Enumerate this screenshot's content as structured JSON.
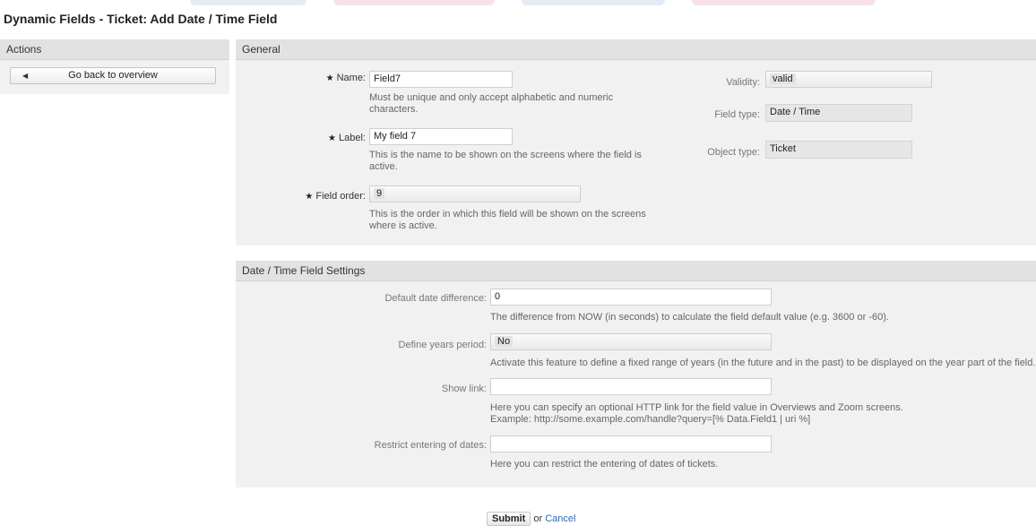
{
  "page_title": "Dynamic Fields - Ticket: Add Date / Time Field",
  "sidebar": {
    "title": "Actions",
    "back_button": "Go back to overview"
  },
  "general": {
    "title": "General",
    "name_label": "Name:",
    "name_value": "Field7",
    "name_hint": "Must be unique and only accept alphabetic and numeric characters.",
    "label_label": "Label:",
    "label_value": "My field 7",
    "label_hint": "This is the name to be shown on the screens where the field is active.",
    "order_label": "Field order:",
    "order_value": "9",
    "order_hint": "This is the order in which this field will be shown on the screens where is active.",
    "validity_label": "Validity:",
    "validity_value": "valid",
    "field_type_label": "Field type:",
    "field_type_value": "Date / Time",
    "object_type_label": "Object type:",
    "object_type_value": "Ticket"
  },
  "settings": {
    "title": "Date / Time Field Settings",
    "default_diff_label": "Default date difference:",
    "default_diff_value": "0",
    "default_diff_hint": "The difference from NOW (in seconds) to calculate the field default value (e.g. 3600 or -60).",
    "years_label": "Define years period:",
    "years_value": "No",
    "years_hint": "Activate this feature to define a fixed range of years (in the future and in the past) to be displayed on the year part of the field.",
    "link_label": "Show link:",
    "link_value": "",
    "link_hint_1": "Here you can specify an optional HTTP link for the field value in Overviews and Zoom screens.",
    "link_hint_2": "Example: http://some.example.com/handle?query=[% Data.Field1 | uri %]",
    "restrict_label": "Restrict entering of dates:",
    "restrict_value": "",
    "restrict_hint": "Here you can restrict the entering of dates of tickets."
  },
  "footer": {
    "submit": "Submit",
    "or": "or",
    "cancel": "Cancel"
  },
  "colors": {
    "panel_bg": "#f1f1f1",
    "panel_header": "#e2e2e2",
    "link": "#2869c5"
  }
}
